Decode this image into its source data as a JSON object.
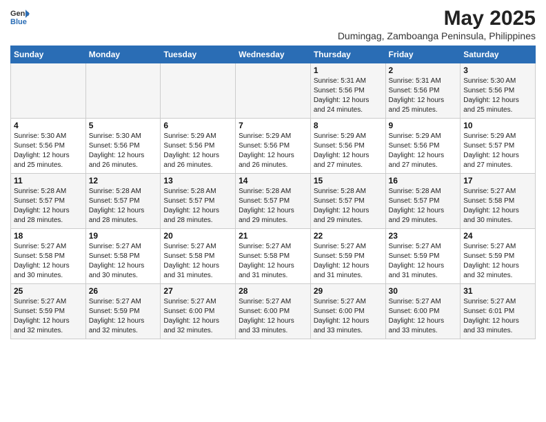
{
  "header": {
    "logo_general": "General",
    "logo_blue": "Blue",
    "main_title": "May 2025",
    "subtitle": "Dumingag, Zamboanga Peninsula, Philippines"
  },
  "calendar": {
    "weekdays": [
      "Sunday",
      "Monday",
      "Tuesday",
      "Wednesday",
      "Thursday",
      "Friday",
      "Saturday"
    ],
    "weeks": [
      [
        {
          "day": "",
          "info": ""
        },
        {
          "day": "",
          "info": ""
        },
        {
          "day": "",
          "info": ""
        },
        {
          "day": "",
          "info": ""
        },
        {
          "day": "1",
          "info": "Sunrise: 5:31 AM\nSunset: 5:56 PM\nDaylight: 12 hours\nand 24 minutes."
        },
        {
          "day": "2",
          "info": "Sunrise: 5:31 AM\nSunset: 5:56 PM\nDaylight: 12 hours\nand 25 minutes."
        },
        {
          "day": "3",
          "info": "Sunrise: 5:30 AM\nSunset: 5:56 PM\nDaylight: 12 hours\nand 25 minutes."
        }
      ],
      [
        {
          "day": "4",
          "info": "Sunrise: 5:30 AM\nSunset: 5:56 PM\nDaylight: 12 hours\nand 25 minutes."
        },
        {
          "day": "5",
          "info": "Sunrise: 5:30 AM\nSunset: 5:56 PM\nDaylight: 12 hours\nand 26 minutes."
        },
        {
          "day": "6",
          "info": "Sunrise: 5:29 AM\nSunset: 5:56 PM\nDaylight: 12 hours\nand 26 minutes."
        },
        {
          "day": "7",
          "info": "Sunrise: 5:29 AM\nSunset: 5:56 PM\nDaylight: 12 hours\nand 26 minutes."
        },
        {
          "day": "8",
          "info": "Sunrise: 5:29 AM\nSunset: 5:56 PM\nDaylight: 12 hours\nand 27 minutes."
        },
        {
          "day": "9",
          "info": "Sunrise: 5:29 AM\nSunset: 5:56 PM\nDaylight: 12 hours\nand 27 minutes."
        },
        {
          "day": "10",
          "info": "Sunrise: 5:29 AM\nSunset: 5:57 PM\nDaylight: 12 hours\nand 27 minutes."
        }
      ],
      [
        {
          "day": "11",
          "info": "Sunrise: 5:28 AM\nSunset: 5:57 PM\nDaylight: 12 hours\nand 28 minutes."
        },
        {
          "day": "12",
          "info": "Sunrise: 5:28 AM\nSunset: 5:57 PM\nDaylight: 12 hours\nand 28 minutes."
        },
        {
          "day": "13",
          "info": "Sunrise: 5:28 AM\nSunset: 5:57 PM\nDaylight: 12 hours\nand 28 minutes."
        },
        {
          "day": "14",
          "info": "Sunrise: 5:28 AM\nSunset: 5:57 PM\nDaylight: 12 hours\nand 29 minutes."
        },
        {
          "day": "15",
          "info": "Sunrise: 5:28 AM\nSunset: 5:57 PM\nDaylight: 12 hours\nand 29 minutes."
        },
        {
          "day": "16",
          "info": "Sunrise: 5:28 AM\nSunset: 5:57 PM\nDaylight: 12 hours\nand 29 minutes."
        },
        {
          "day": "17",
          "info": "Sunrise: 5:27 AM\nSunset: 5:58 PM\nDaylight: 12 hours\nand 30 minutes."
        }
      ],
      [
        {
          "day": "18",
          "info": "Sunrise: 5:27 AM\nSunset: 5:58 PM\nDaylight: 12 hours\nand 30 minutes."
        },
        {
          "day": "19",
          "info": "Sunrise: 5:27 AM\nSunset: 5:58 PM\nDaylight: 12 hours\nand 30 minutes."
        },
        {
          "day": "20",
          "info": "Sunrise: 5:27 AM\nSunset: 5:58 PM\nDaylight: 12 hours\nand 31 minutes."
        },
        {
          "day": "21",
          "info": "Sunrise: 5:27 AM\nSunset: 5:58 PM\nDaylight: 12 hours\nand 31 minutes."
        },
        {
          "day": "22",
          "info": "Sunrise: 5:27 AM\nSunset: 5:59 PM\nDaylight: 12 hours\nand 31 minutes."
        },
        {
          "day": "23",
          "info": "Sunrise: 5:27 AM\nSunset: 5:59 PM\nDaylight: 12 hours\nand 31 minutes."
        },
        {
          "day": "24",
          "info": "Sunrise: 5:27 AM\nSunset: 5:59 PM\nDaylight: 12 hours\nand 32 minutes."
        }
      ],
      [
        {
          "day": "25",
          "info": "Sunrise: 5:27 AM\nSunset: 5:59 PM\nDaylight: 12 hours\nand 32 minutes."
        },
        {
          "day": "26",
          "info": "Sunrise: 5:27 AM\nSunset: 5:59 PM\nDaylight: 12 hours\nand 32 minutes."
        },
        {
          "day": "27",
          "info": "Sunrise: 5:27 AM\nSunset: 6:00 PM\nDaylight: 12 hours\nand 32 minutes."
        },
        {
          "day": "28",
          "info": "Sunrise: 5:27 AM\nSunset: 6:00 PM\nDaylight: 12 hours\nand 33 minutes."
        },
        {
          "day": "29",
          "info": "Sunrise: 5:27 AM\nSunset: 6:00 PM\nDaylight: 12 hours\nand 33 minutes."
        },
        {
          "day": "30",
          "info": "Sunrise: 5:27 AM\nSunset: 6:00 PM\nDaylight: 12 hours\nand 33 minutes."
        },
        {
          "day": "31",
          "info": "Sunrise: 5:27 AM\nSunset: 6:01 PM\nDaylight: 12 hours\nand 33 minutes."
        }
      ]
    ]
  }
}
